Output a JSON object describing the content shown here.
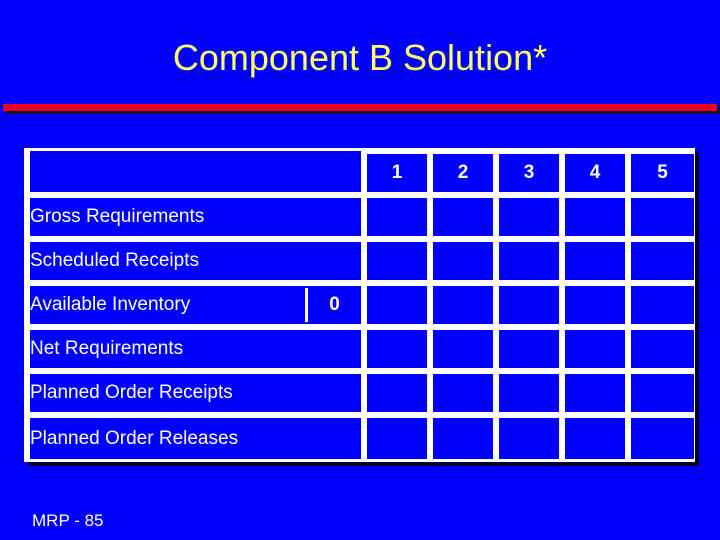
{
  "slide": {
    "title": "Component B Solution*",
    "footer": "MRP - 85",
    "background_color": "#0000FF",
    "title_color": "#FFFF66",
    "rule_color": "#EE0022",
    "text_color": "#FFFFFF"
  },
  "table": {
    "corner_header": "",
    "period_headers": [
      "1",
      "2",
      "3",
      "4",
      "5"
    ],
    "rows": [
      {
        "label": "Gross Requirements",
        "cells": [
          "",
          "",
          "",
          "",
          ""
        ]
      },
      {
        "label": "Scheduled Receipts",
        "cells": [
          "",
          "",
          "",
          "",
          ""
        ]
      },
      {
        "label": "Available Inventory",
        "on_hand": "0",
        "cells": [
          "",
          "",
          "",
          "",
          ""
        ]
      },
      {
        "label": "Net Requirements",
        "cells": [
          "",
          "",
          "",
          "",
          ""
        ]
      },
      {
        "label": "Planned Order Receipts",
        "cells": [
          "",
          "",
          "",
          "",
          ""
        ]
      },
      {
        "label": "Planned Order Releases",
        "cells": [
          "",
          "",
          "",
          "",
          ""
        ]
      }
    ]
  }
}
